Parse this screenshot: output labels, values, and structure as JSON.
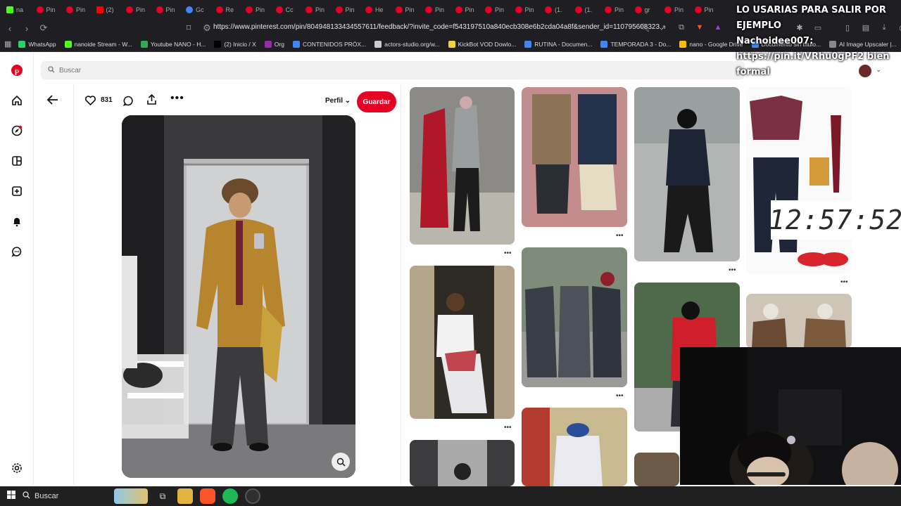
{
  "browser": {
    "tabs": [
      {
        "label": "na",
        "icon": "kick"
      },
      {
        "label": "Pin",
        "icon": "pinterest"
      },
      {
        "label": "Pin",
        "icon": "pinterest"
      },
      {
        "label": "(2)",
        "icon": "youtube"
      },
      {
        "label": "Pin",
        "icon": "pinterest"
      },
      {
        "label": "Pin",
        "icon": "pinterest"
      },
      {
        "label": "Gc",
        "icon": "google"
      },
      {
        "label": "Re",
        "icon": "pinterest"
      },
      {
        "label": "Pin",
        "icon": "pinterest"
      },
      {
        "label": "Cc",
        "icon": "pinterest"
      },
      {
        "label": "Pin",
        "icon": "pinterest"
      },
      {
        "label": "Pin",
        "icon": "pinterest"
      },
      {
        "label": "He",
        "icon": "pinterest"
      },
      {
        "label": "Pin",
        "icon": "pinterest"
      },
      {
        "label": "Pin",
        "icon": "pinterest"
      },
      {
        "label": "Pin",
        "icon": "pinterest"
      },
      {
        "label": "Pin",
        "icon": "pinterest"
      },
      {
        "label": "Pin",
        "icon": "pinterest"
      },
      {
        "label": "(1.",
        "icon": "pinterest"
      },
      {
        "label": "(1.",
        "icon": "pinterest"
      },
      {
        "label": "Pin",
        "icon": "pinterest"
      },
      {
        "label": "gr",
        "icon": "pinterest"
      },
      {
        "label": "Pin",
        "icon": "pinterest"
      },
      {
        "label": "Pin",
        "icon": "pinterest"
      }
    ],
    "url": "https://www.pinterest.com/pin/804948133434557611/feedback/?invite_code=f543197510a840ecb308e6b2cda04a8f&sender_id=110795608323...",
    "bookmarks": [
      {
        "label": "WhatsApp",
        "color": "#25d366"
      },
      {
        "label": "nanoide Stream - W...",
        "color": "#53fc18"
      },
      {
        "label": "Youtube NANO - H...",
        "color": "#34a853"
      },
      {
        "label": "(2) Inicio / X",
        "color": "#000000"
      },
      {
        "label": "Org",
        "color": "#9c27b0"
      },
      {
        "label": "CONTENIDOS PRÓX...",
        "color": "#4285f4"
      },
      {
        "label": "actors-studio.org/w...",
        "color": "#cccccc"
      },
      {
        "label": "KickBot VOD Dowlo...",
        "color": "#f4d03f"
      },
      {
        "label": "RUTINA - Documen...",
        "color": "#4285f4"
      },
      {
        "label": "TEMPORADA 3 - Do...",
        "color": "#4285f4"
      },
      {
        "label": "nano - Google Drive",
        "color": "#fbbc04"
      },
      {
        "label": "Documento sin título...",
        "color": "#4285f4"
      },
      {
        "label": "AI Image Upscaler |...",
        "color": "#888888"
      }
    ]
  },
  "pinterest": {
    "search_placeholder": "Buscar",
    "likes": "831",
    "perfil_label": "Perfil",
    "save_label": "Guardar",
    "accent": "#e60023"
  },
  "overlay": {
    "line1": "LO USARIAS PARA SALIR POR",
    "line2": "EJEMPLO",
    "line3": "Nachoidee007:",
    "line4": "https://pin.it/VRhu0gPF2 bien",
    "line5": "formal",
    "clock": "12:57:52"
  },
  "taskbar": {
    "search_label": "Buscar"
  }
}
